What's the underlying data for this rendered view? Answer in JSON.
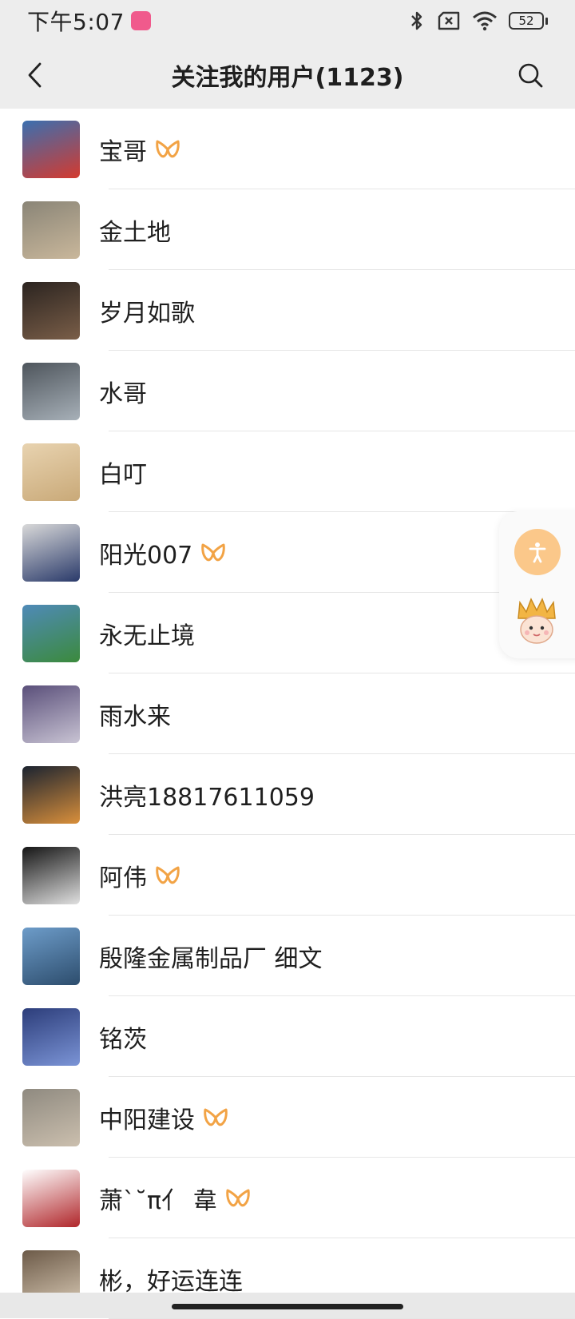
{
  "status_bar": {
    "time": "下午5:07",
    "app_badge": "bilibili",
    "battery": "52",
    "icons": [
      "bluetooth-icon",
      "sim-x-icon",
      "wifi-icon",
      "battery-icon"
    ]
  },
  "header": {
    "title": "关注我的用户(1123)",
    "back_icon": "chevron-left-icon",
    "search_icon": "search-icon"
  },
  "users": [
    {
      "name": "宝哥",
      "badge": true,
      "colors": [
        "#3a6fb0",
        "#d43a2f"
      ]
    },
    {
      "name": "金土地",
      "badge": false,
      "colors": [
        "#8a8577",
        "#c9b79b"
      ]
    },
    {
      "name": "岁月如歌",
      "badge": false,
      "colors": [
        "#2b2420",
        "#7a5e48"
      ]
    },
    {
      "name": "水哥",
      "badge": false,
      "colors": [
        "#4e555c",
        "#a7b0b8"
      ]
    },
    {
      "name": "白叮",
      "badge": false,
      "colors": [
        "#e8d3b0",
        "#c9a978"
      ]
    },
    {
      "name": "阳光007",
      "badge": true,
      "colors": [
        "#d9d9d9",
        "#2a3a6a"
      ]
    },
    {
      "name": "永无止境",
      "badge": false,
      "colors": [
        "#4f8ab8",
        "#3b8a3c"
      ]
    },
    {
      "name": "雨水来",
      "badge": false,
      "colors": [
        "#5a4f7a",
        "#c8c3d3"
      ]
    },
    {
      "name": "洪亮18817611059",
      "badge": false,
      "colors": [
        "#1b2330",
        "#d98f3b"
      ]
    },
    {
      "name": "阿伟",
      "badge": true,
      "colors": [
        "#151515",
        "#e0e0e0"
      ]
    },
    {
      "name": "殷隆金属制品厂 细文",
      "badge": false,
      "colors": [
        "#6d9cc9",
        "#2d4d6d"
      ]
    },
    {
      "name": "铭茨",
      "badge": false,
      "colors": [
        "#2c3d7a",
        "#7b94d6"
      ]
    },
    {
      "name": "中阳建设",
      "badge": true,
      "colors": [
        "#8f8a80",
        "#cbbfae"
      ]
    },
    {
      "name": "萧ˋ˘π亻 韋",
      "badge": true,
      "colors": [
        "#ffffff",
        "#b0262a"
      ]
    },
    {
      "name": "彬，好运连连",
      "badge": false,
      "colors": [
        "#6c5a48",
        "#d7c8b3"
      ]
    }
  ],
  "floating": {
    "accessibility_icon": "accessibility-icon",
    "mascot_icon": "mascot-sticker-icon"
  },
  "colors": {
    "badge": "#f2a345",
    "header_bg": "#ededed",
    "divider": "#e6e6e6"
  }
}
